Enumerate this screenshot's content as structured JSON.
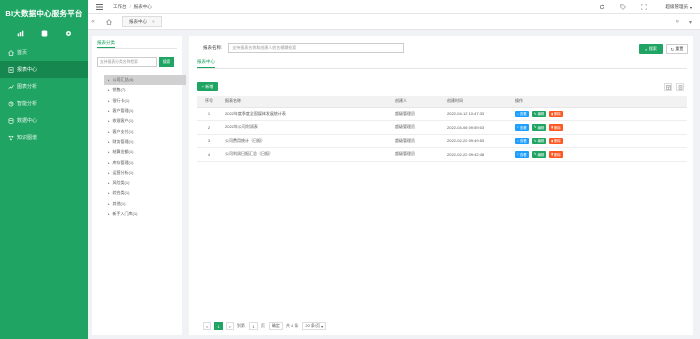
{
  "app": {
    "title": "BI大数据中心服务平台"
  },
  "sidebar": {
    "top_icons": [
      "chart-icon",
      "database-icon",
      "gear-icon"
    ],
    "items": [
      {
        "label": "首页",
        "icon": "home-icon",
        "active": false
      },
      {
        "label": "报表中心",
        "icon": "report-icon",
        "active": true
      },
      {
        "label": "图表分析",
        "icon": "chart-icon",
        "active": false
      },
      {
        "label": "智能分析",
        "icon": "analysis-icon",
        "active": false
      },
      {
        "label": "数据中心",
        "icon": "database-icon",
        "active": false
      },
      {
        "label": "知识图谱",
        "icon": "graph-icon",
        "active": false
      }
    ]
  },
  "header": {
    "breadcrumb": [
      "工作台",
      "报表中心"
    ],
    "user": "超级管理员"
  },
  "tabs": [
    {
      "label": "报表中心",
      "close": "×"
    }
  ],
  "category_panel": {
    "title": "报表分类",
    "search_placeholder": "支持报表分类名称检索",
    "search_button": "搜索",
    "items": [
      "公司汇总(4)",
      "销售(7)",
      "银行卡(1)",
      "客户管理(1)",
      "收银客户(1)",
      "客户支付(1)",
      "财务管理(1)",
      "结算金额(1)",
      "库存管理(1)",
      "运营分析(1)",
      "风险类(1)",
      "综合类(1)",
      "其他(1)",
      "新手入门库(1)"
    ]
  },
  "main": {
    "search_label": "报表名称:",
    "search_placeholder": "支持报表名称和创建人姓名模糊检索",
    "search_button": "搜索",
    "reset_button": "重置",
    "sub_tab": "报表中心",
    "add_button": "+ 新增",
    "table": {
      "headers": [
        "序号",
        "报表名称",
        "创建人",
        "创建时间",
        "操作"
      ],
      "rows": [
        {
          "no": "1",
          "name": "2022年度季度全国媒体发展统计表",
          "creator": "超级管理员",
          "time": "2022-04-12 10:47:33"
        },
        {
          "no": "2",
          "name": "2022年公司利润表",
          "creator": "超级管理员",
          "time": "2022-04-06 09:59:03"
        },
        {
          "no": "3",
          "name": "公司费用统计（日报）",
          "creator": "超级管理员",
          "time": "2022-02-22 09:49:53"
        },
        {
          "no": "4",
          "name": "公司利润日报汇总（日报）",
          "creator": "超级管理员",
          "time": "2022-02-22 09:42:48"
        }
      ],
      "ops": {
        "view": "查看",
        "edit": "编辑",
        "delete": "删除"
      }
    },
    "pager": {
      "prev": "<",
      "current": "1",
      "next": ">",
      "goto_label": "到第",
      "goto_value": "1",
      "page_unit": "页",
      "confirm": "确定",
      "total": "共 4 条",
      "page_size": "20 条/页"
    }
  },
  "colors": {
    "primary": "#1fa463",
    "primary_dark": "#16884f",
    "view": "#1e9fff",
    "delete": "#ff5722"
  }
}
